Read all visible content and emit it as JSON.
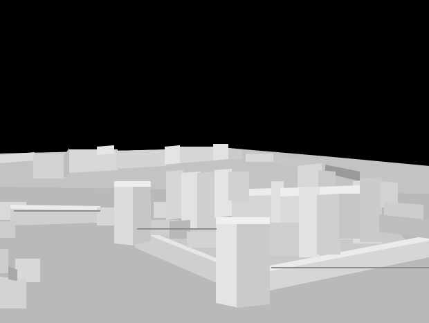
{
  "scene": {
    "subject": "castle-3d-model",
    "colors": {
      "sky": "#000000",
      "ground": "#b8b8b8",
      "ground_far": "#c4c4c4",
      "wall_light": "#dedede",
      "wall_mid": "#cfcfcf",
      "wall_dark": "#a9a9a9",
      "top": "#eeeeee"
    }
  }
}
